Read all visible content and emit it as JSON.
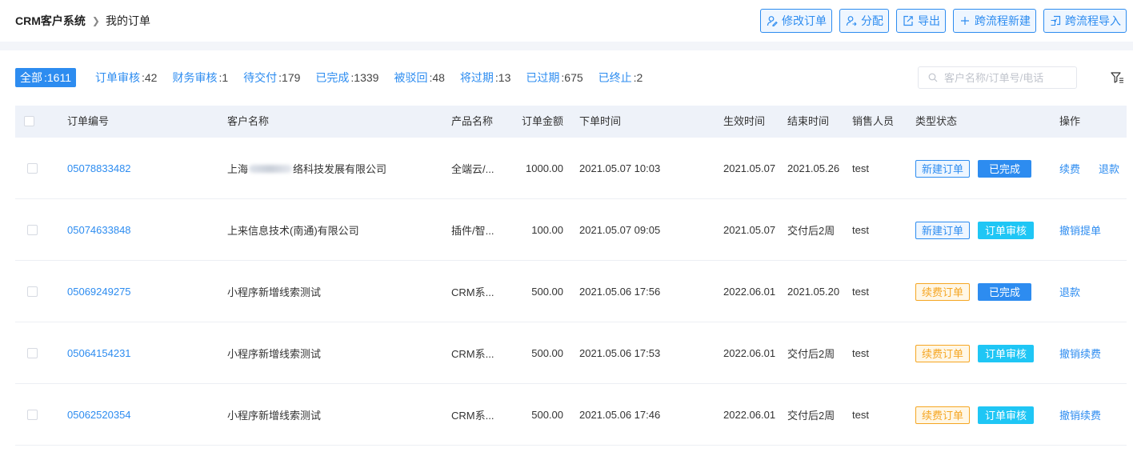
{
  "breadcrumb": {
    "root": "CRM客户系统",
    "current": "我的订单"
  },
  "toolbar": [
    {
      "label": "修改订单",
      "icon": "user-edit-icon"
    },
    {
      "label": "分配",
      "icon": "user-assign-icon"
    },
    {
      "label": "导出",
      "icon": "export-icon"
    },
    {
      "label": "跨流程新建",
      "icon": "plus-icon"
    },
    {
      "label": "跨流程导入",
      "icon": "import-icon"
    }
  ],
  "tabs": [
    {
      "label": "全部",
      "count": ":1611",
      "active": true
    },
    {
      "label": "订单审核",
      "count": ":42"
    },
    {
      "label": "财务审核",
      "count": ":1"
    },
    {
      "label": "待交付",
      "count": ":179"
    },
    {
      "label": "已完成",
      "count": ":1339"
    },
    {
      "label": "被驳回",
      "count": ":48"
    },
    {
      "label": "将过期",
      "count": ":13"
    },
    {
      "label": "已过期",
      "count": ":675"
    },
    {
      "label": "已终止",
      "count": ":2"
    }
  ],
  "search": {
    "placeholder": "客户名称/订单号/电话"
  },
  "table": {
    "columns": [
      "订单编号",
      "客户名称",
      "产品名称",
      "订单金额",
      "下单时间",
      "生效时间",
      "结束时间",
      "销售人员",
      "类型状态",
      "操作"
    ],
    "rows": [
      {
        "order_no": "05078833482",
        "customer_prefix": "上海",
        "customer_suffix": "络科技发展有限公司",
        "product": "全端云/...",
        "amount": "1000.00",
        "order_time": "2021.05.07 10:03",
        "effective": "2021.05.07",
        "end": "2021.05.26",
        "sales": "test",
        "type": "新建订单",
        "type_kind": "new",
        "status": "已完成",
        "status_kind": "done",
        "ops": [
          "续费",
          "退款"
        ]
      },
      {
        "order_no": "05074633848",
        "customer": "上来信息技术(南通)有限公司",
        "product": "插件/智...",
        "amount": "100.00",
        "order_time": "2021.05.07 09:05",
        "effective": "2021.05.07",
        "end": "交付后2周",
        "sales": "test",
        "type": "新建订单",
        "type_kind": "new",
        "status": "订单审核",
        "status_kind": "review",
        "ops": [
          "撤销提单"
        ]
      },
      {
        "order_no": "05069249275",
        "customer": "小程序新增线索测试",
        "product": "CRM系...",
        "amount": "500.00",
        "order_time": "2021.05.06 17:56",
        "effective": "2022.06.01",
        "end": "2021.05.20",
        "sales": "test",
        "type": "续费订单",
        "type_kind": "renew",
        "status": "已完成",
        "status_kind": "done",
        "ops": [
          "退款"
        ]
      },
      {
        "order_no": "05064154231",
        "customer": "小程序新增线索测试",
        "product": "CRM系...",
        "amount": "500.00",
        "order_time": "2021.05.06 17:53",
        "effective": "2022.06.01",
        "end": "交付后2周",
        "sales": "test",
        "type": "续费订单",
        "type_kind": "renew",
        "status": "订单审核",
        "status_kind": "review",
        "ops": [
          "撤销续费"
        ]
      },
      {
        "order_no": "05062520354",
        "customer": "小程序新增线索测试",
        "product": "CRM系...",
        "amount": "500.00",
        "order_time": "2021.05.06 17:46",
        "effective": "2022.06.01",
        "end": "交付后2周",
        "sales": "test",
        "type": "续费订单",
        "type_kind": "renew",
        "status": "订单审核",
        "status_kind": "review",
        "ops": [
          "撤销续费"
        ]
      }
    ]
  }
}
